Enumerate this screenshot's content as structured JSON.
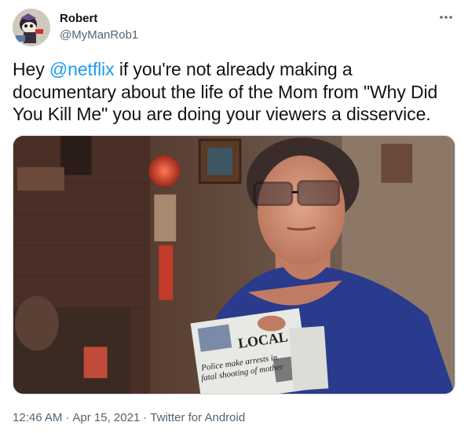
{
  "user": {
    "display_name": "Robert",
    "handle": "@MyManRob1",
    "avatar_icon": "avatar-icon"
  },
  "more_icon": "more-icon",
  "tweet": {
    "text_before": "Hey ",
    "mention": "@netflix",
    "text_after": " if you're not already making a documentary about the life of the Mom from \"Why Did You Kill Me\" you are doing your viewers a disservice."
  },
  "media": {
    "newspaper_masthead": "LOCAL",
    "newspaper_headline_line1": "Police make arrests in",
    "newspaper_headline_line2": "fatal shooting of mother"
  },
  "meta": {
    "time": "12:46 AM",
    "separator": "·",
    "date": "Apr 15, 2021",
    "source": "Twitter for Android"
  },
  "colors": {
    "link": "#1d9bf0",
    "text": "#0f1419",
    "secondary": "#536471",
    "border": "#cfd9de"
  }
}
